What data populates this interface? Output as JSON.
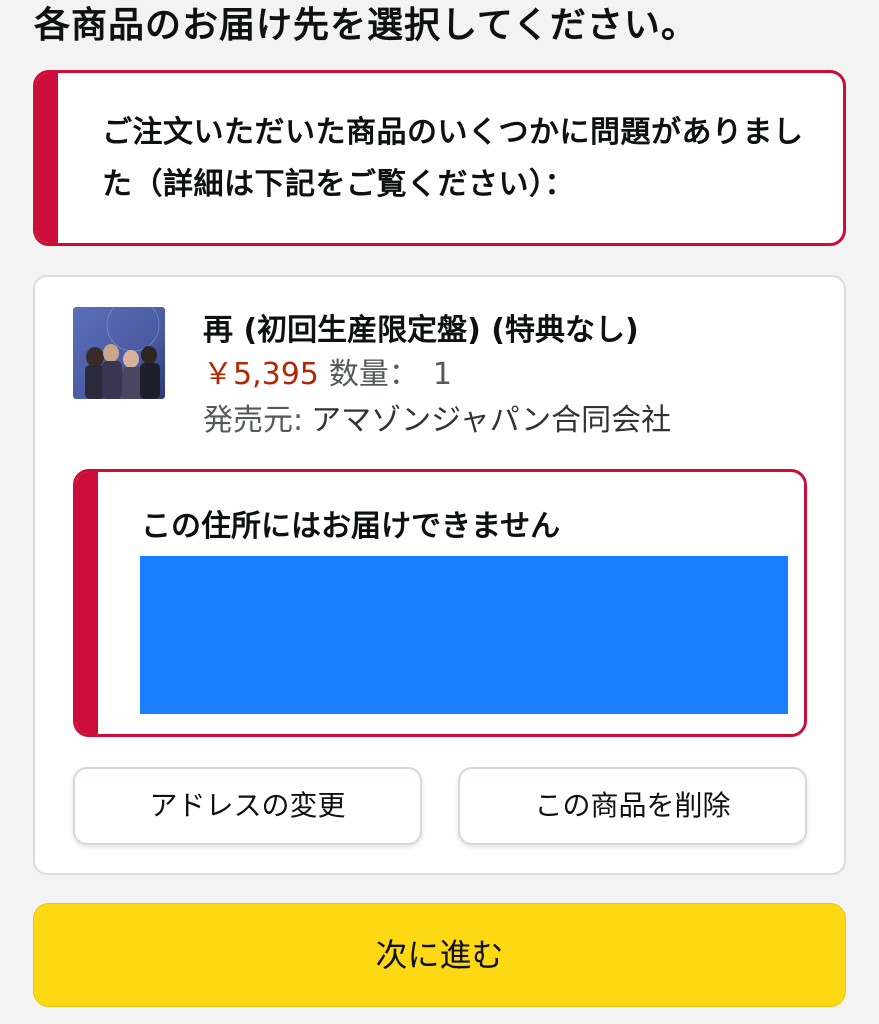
{
  "page": {
    "title": "各商品のお届け先を選択してください。"
  },
  "error_alert": {
    "message": "ご注文いただいた商品のいくつかに問題がありました（詳細は下記をご覧ください）："
  },
  "item": {
    "title": "再 (初回生産限定盤) (特典なし)",
    "price": "￥5,395",
    "quantity_label": "数量：",
    "quantity_value": "1",
    "seller_label": "発売元:",
    "seller_name": "アマゾンジャパン合同会社"
  },
  "address_alert": {
    "message": "この住所にはお届けできません",
    "redaction_color": "#1a7fff"
  },
  "actions": {
    "change_address": "アドレスの変更",
    "delete_item": "この商品を削除",
    "continue": "次に進む"
  },
  "colors": {
    "alert_red": "#cc0c39",
    "price": "#b12704",
    "continue_button": "#ffd814"
  }
}
